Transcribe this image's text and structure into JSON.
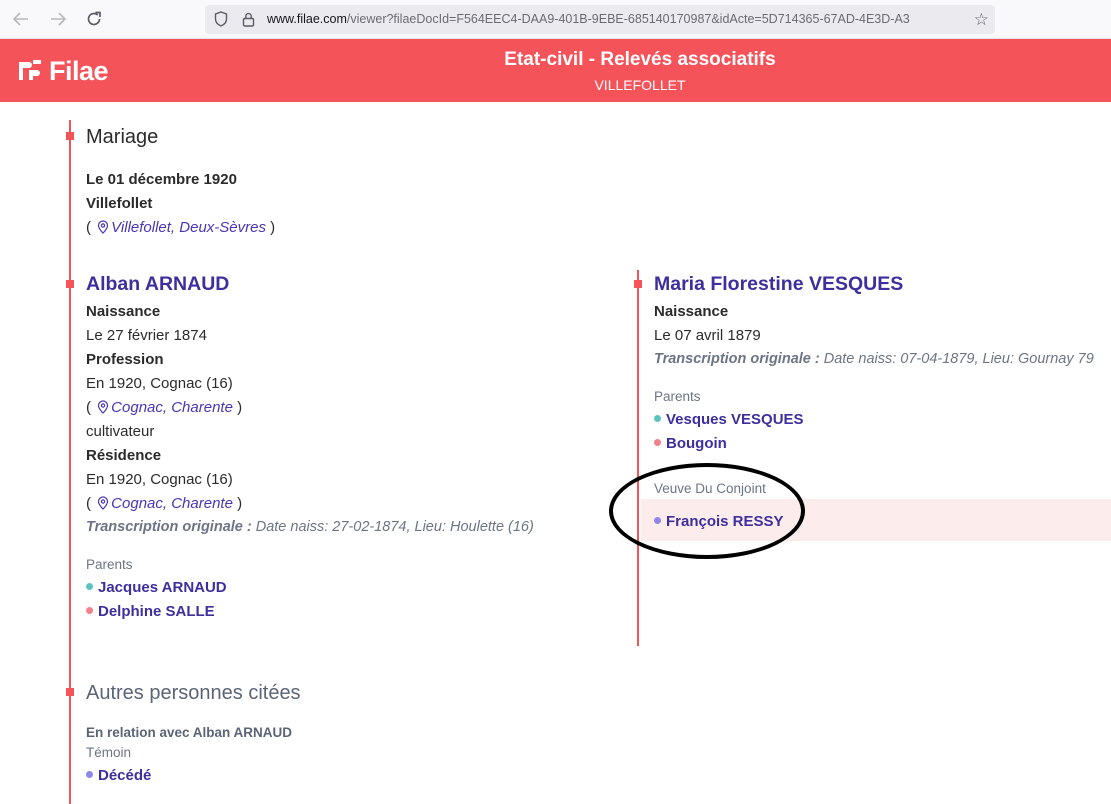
{
  "browser": {
    "url_host": "www.filae.com",
    "url_path": "/viewer?filaeDocId=F564EEC4-DAA9-401B-9EBE-685140170987&idActe=5D714365-67AD-4E3D-A3",
    "icons": [
      "back-icon",
      "forward-icon",
      "reload-icon",
      "shield-icon",
      "lock-icon",
      "star-icon"
    ]
  },
  "header": {
    "logo_text": "Filae",
    "title": "Etat-civil - Relevés associatifs",
    "subtitle": "VILLEFOLLET",
    "bg_color": "#f5535a"
  },
  "event": {
    "title": "Mariage",
    "date": "Le 01 décembre 1920",
    "town": "Villefollet",
    "place_open": "(",
    "place_link": "Villefollet, Deux-Sèvres",
    "place_close": ")"
  },
  "groom": {
    "name": "Alban ARNAUD",
    "birth_label": "Naissance",
    "birth_date": "Le 27 février 1874",
    "profession_label": "Profession",
    "profession_where": "En 1920, Cognac (16)",
    "profession_place_link": "Cognac, Charente",
    "profession_value": "cultivateur",
    "residence_label": "Résidence",
    "residence_where": "En 1920, Cognac (16)",
    "residence_place_link": "Cognac, Charente",
    "transcription_label": "Transcription originale :",
    "transcription_value": "Date naiss: 27-02-1874, Lieu: Houlette (16)",
    "parents_label": "Parents",
    "father": "Jacques ARNAUD",
    "mother": "Delphine SALLE",
    "paren_open": "(",
    "paren_close": ")"
  },
  "bride": {
    "name": "Maria Florestine VESQUES",
    "birth_label": "Naissance",
    "birth_date": "Le 07 avril 1879",
    "transcription_label": "Transcription originale :",
    "transcription_value": "Date naiss: 07-04-1879, Lieu: Gournay 79",
    "parents_label": "Parents",
    "father": "Vesques VESQUES",
    "mother": "Bougoin",
    "spouse_label": "Veuve Du Conjoint",
    "former_spouse": "François RESSY"
  },
  "others": {
    "title": "Autres personnes citées",
    "relation_label": "En relation avec Alban ARNAUD",
    "role": "Témoin",
    "person": "Décédé"
  },
  "colors": {
    "accent": "#f5535a",
    "link": "#3d2f9e",
    "male_dot": "#5bc3c0",
    "female_dot": "#f0808a",
    "other_dot": "#8f86ea"
  }
}
